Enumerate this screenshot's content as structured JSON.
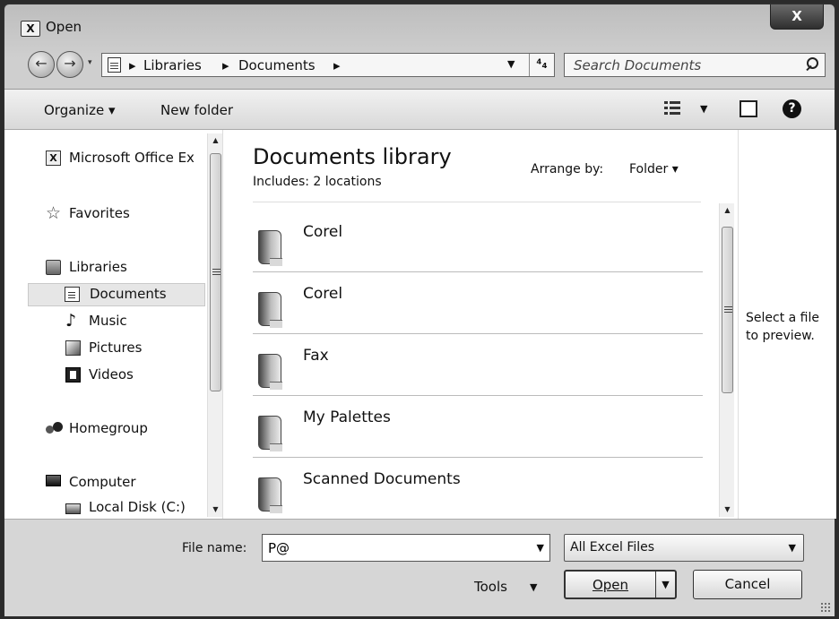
{
  "window": {
    "title": "Open",
    "app_icon": "X",
    "close_label": "X"
  },
  "nav": {
    "back_label": "←",
    "forward_label": "→"
  },
  "address": {
    "crumbs": [
      "Libraries",
      "Documents"
    ],
    "separator": "▸"
  },
  "search": {
    "placeholder": "Search Documents"
  },
  "toolbar": {
    "organize": "Organize ▾",
    "new_folder": "New folder"
  },
  "sidebar": {
    "items": [
      {
        "label": "Microsoft Office Ex",
        "icon": "office-icon"
      },
      {
        "label": "Favorites",
        "icon": "star-icon"
      },
      {
        "label": "Libraries",
        "icon": "libraries-icon"
      },
      {
        "label": "Documents",
        "icon": "documents-icon",
        "selected": true
      },
      {
        "label": "Music",
        "icon": "music-icon"
      },
      {
        "label": "Pictures",
        "icon": "pictures-icon"
      },
      {
        "label": "Videos",
        "icon": "videos-icon"
      },
      {
        "label": "Homegroup",
        "icon": "homegroup-icon"
      },
      {
        "label": "Computer",
        "icon": "computer-icon"
      },
      {
        "label": "Local Disk (C:)",
        "icon": "disk-icon"
      }
    ]
  },
  "library": {
    "title": "Documents library",
    "subtitle": "Includes: 2 locations",
    "arrange_label": "Arrange by:",
    "arrange_value": "Folder ▾"
  },
  "files": [
    "Corel",
    "Corel",
    "Fax",
    "My Palettes",
    "Scanned Documents"
  ],
  "preview": {
    "text": "Select a file to preview."
  },
  "bottom": {
    "filename_label": "File name:",
    "filename_value": "P@",
    "filter_value": "All Excel Files",
    "tools_label": "Tools",
    "open_label": "Open",
    "cancel_label": "Cancel"
  }
}
